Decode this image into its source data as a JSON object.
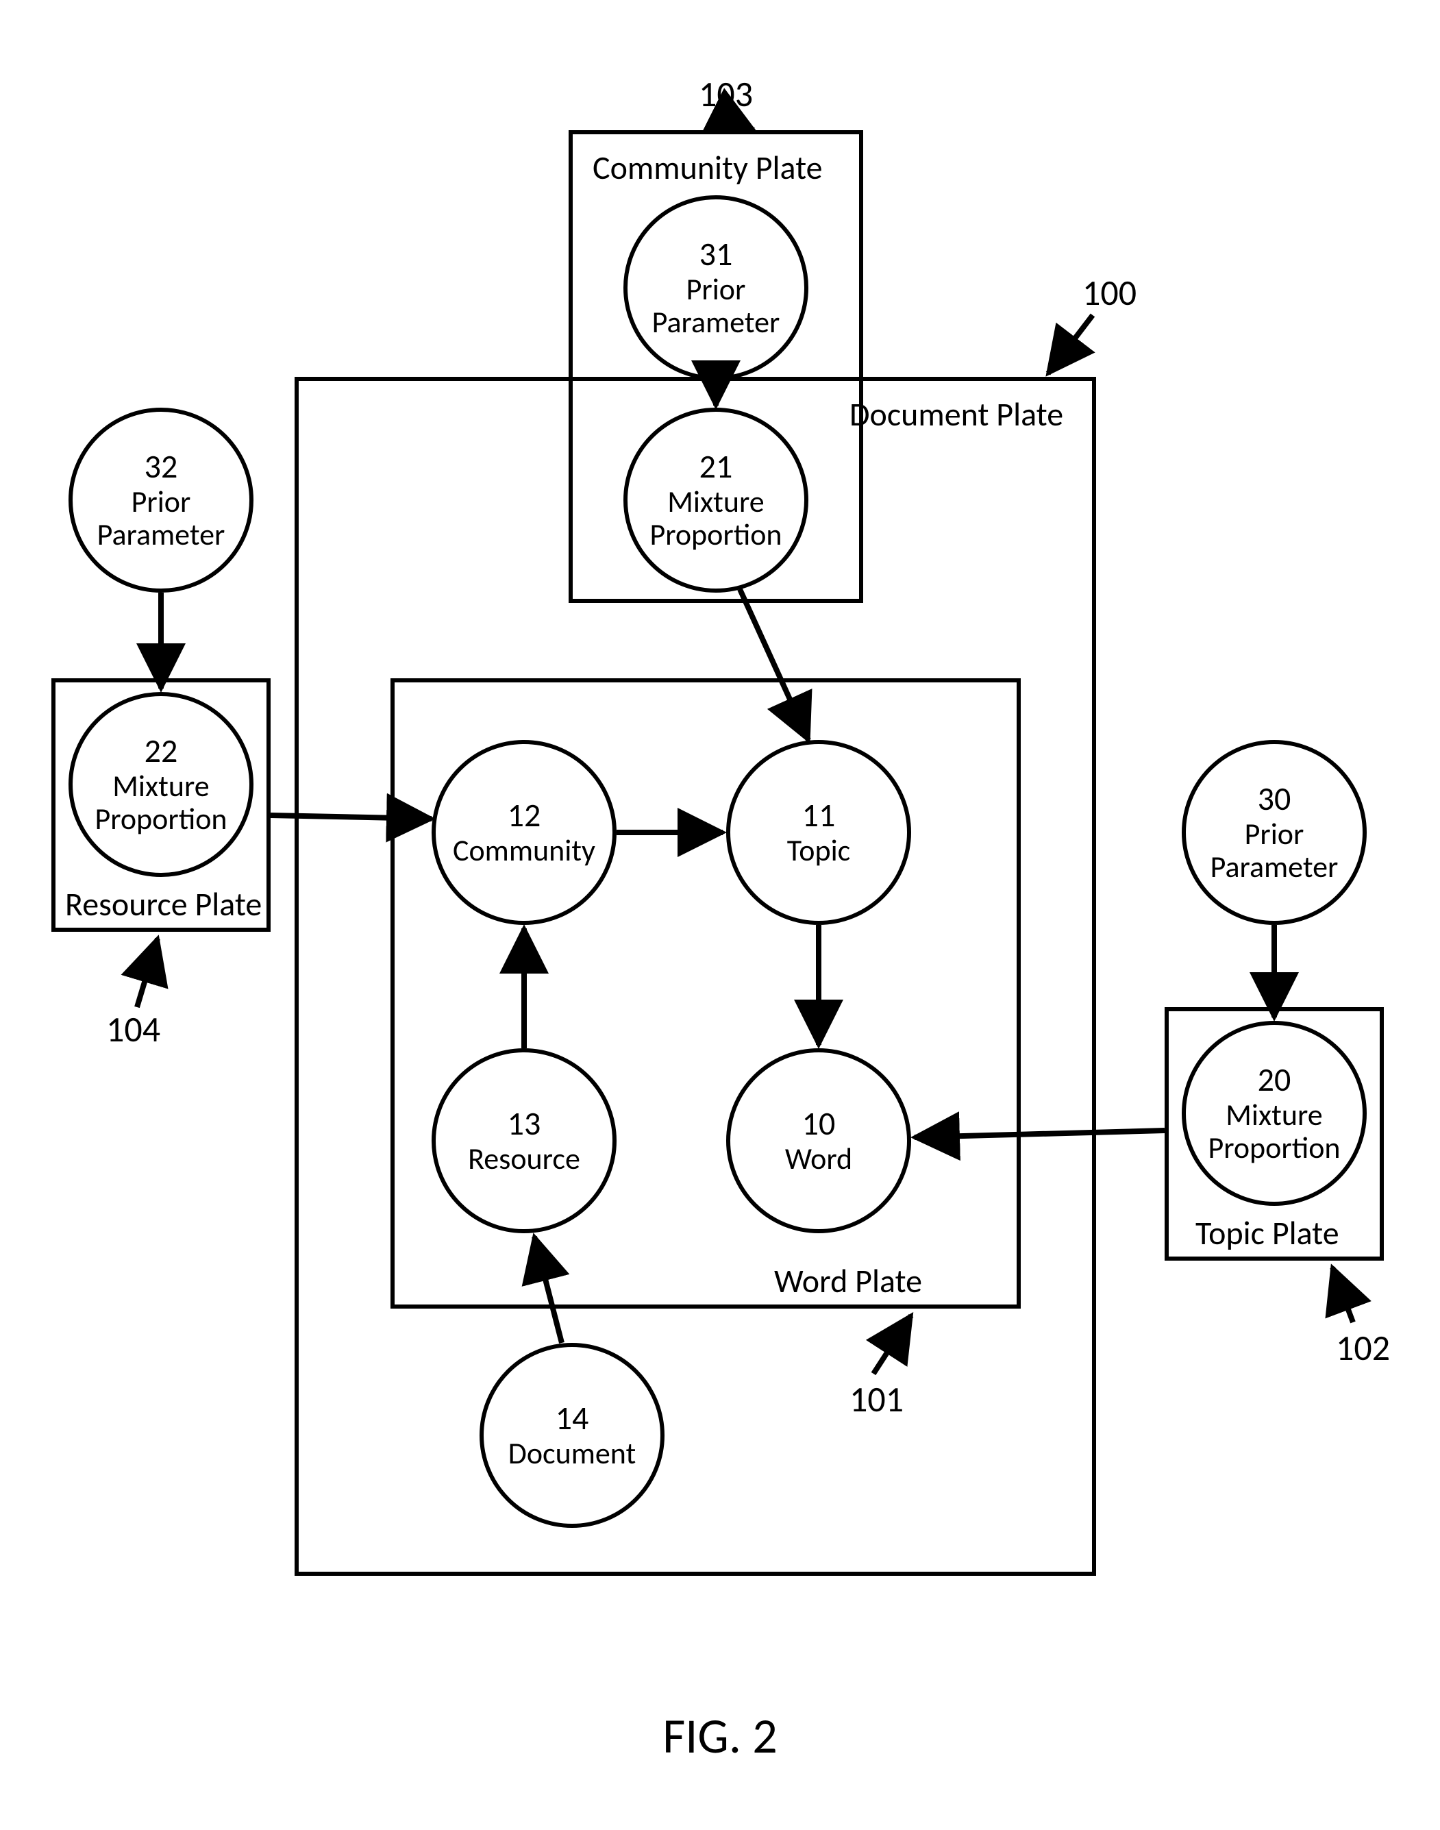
{
  "figureCaption": "FIG. 2",
  "plates": {
    "documentPlate": {
      "label": "Document Plate",
      "ref": "100"
    },
    "wordPlate": {
      "label": "Word Plate",
      "ref": "101"
    },
    "communityPlate": {
      "label": "Community Plate",
      "ref": "103"
    },
    "resourcePlate": {
      "label": "Resource Plate",
      "ref": "104"
    },
    "topicPlate": {
      "label": "Topic Plate",
      "ref": "102"
    }
  },
  "nodes": {
    "n10": {
      "num": "10",
      "label": "Word"
    },
    "n11": {
      "num": "11",
      "label": "Topic"
    },
    "n12": {
      "num": "12",
      "label": "Community"
    },
    "n13": {
      "num": "13",
      "label": "Resource"
    },
    "n14": {
      "num": "14",
      "label": "Document"
    },
    "n20": {
      "num": "20",
      "label": "Mixture Proportion"
    },
    "n21": {
      "num": "21",
      "label": "Mixture Proportion"
    },
    "n22": {
      "num": "22",
      "label": "Mixture Proportion"
    },
    "n30": {
      "num": "30",
      "label": "Prior Parameter"
    },
    "n31": {
      "num": "31",
      "label": "Prior Parameter"
    },
    "n32": {
      "num": "32",
      "label": "Prior Parameter"
    }
  }
}
